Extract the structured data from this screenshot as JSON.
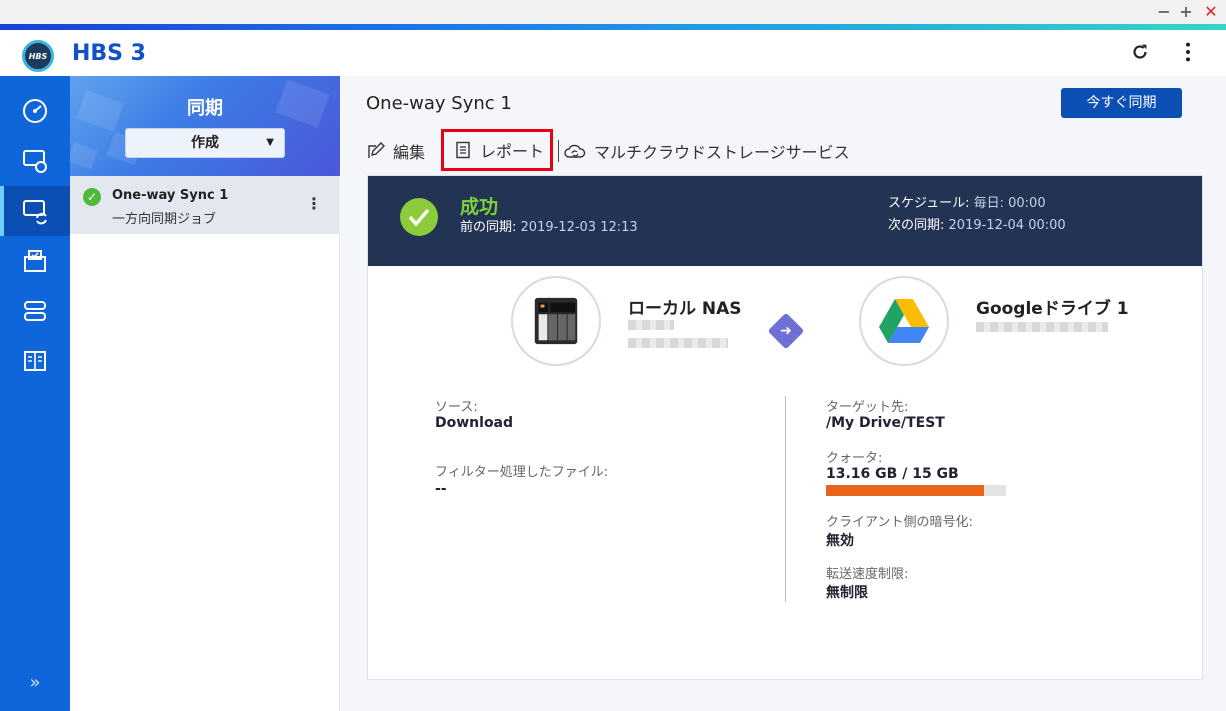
{
  "window": {
    "minimize": "−",
    "maximize": "+",
    "close": "✕"
  },
  "app": {
    "title": "HBS 3",
    "logo_text": "HBS"
  },
  "header": {
    "refresh_icon": "refresh-icon",
    "menu_icon": "kebab-icon"
  },
  "rail": {
    "items": [
      {
        "icon": "dashboard-icon",
        "active": false
      },
      {
        "icon": "backup-restore-icon",
        "active": false
      },
      {
        "icon": "sync-icon",
        "active": true
      },
      {
        "icon": "job-list-icon",
        "active": false
      },
      {
        "icon": "storage-icon",
        "active": false
      },
      {
        "icon": "logs-icon",
        "active": false
      }
    ],
    "expand": "»"
  },
  "panel": {
    "title": "同期",
    "create_label": "作成",
    "job": {
      "name": "One-way Sync 1",
      "type": "一方向同期ジョブ"
    }
  },
  "main": {
    "title": "One-way Sync 1",
    "sync_now": "今すぐ同期",
    "toolbar": {
      "edit": "編集",
      "report": "レポート",
      "multicloud": "マルチクラウドストレージサービス"
    }
  },
  "status": {
    "result": "成功",
    "last_sync_label": "前の同期:",
    "last_sync_value": "2019-12-03 12:13",
    "schedule_label": "スケジュール:",
    "schedule_value": "毎日: 00:00",
    "next_sync_label": "次の同期:",
    "next_sync_value": "2019-12-04 00:00",
    "colors": {
      "banner": "#233354",
      "success": "#7dd13a",
      "quota": "#e8641a",
      "accent": "#0b4fb5"
    }
  },
  "endpoints": {
    "source_name": "ローカル NAS",
    "destination_name": "Googleドライブ 1"
  },
  "details": {
    "source_label": "ソース:",
    "source_value": "Download",
    "filter_label": "フィルター処理したファイル:",
    "filter_value": "--",
    "target_label": "ターゲット先:",
    "target_value": "/My Drive/TEST",
    "quota_label": "クォータ:",
    "quota_used": "13.16 GB",
    "quota_sep": " / ",
    "quota_total": "15 GB",
    "quota_fraction": 0.877,
    "encryption_label": "クライアント側の暗号化:",
    "encryption_value": "無効",
    "speed_label": "転送速度制限:",
    "speed_value": "無制限"
  }
}
